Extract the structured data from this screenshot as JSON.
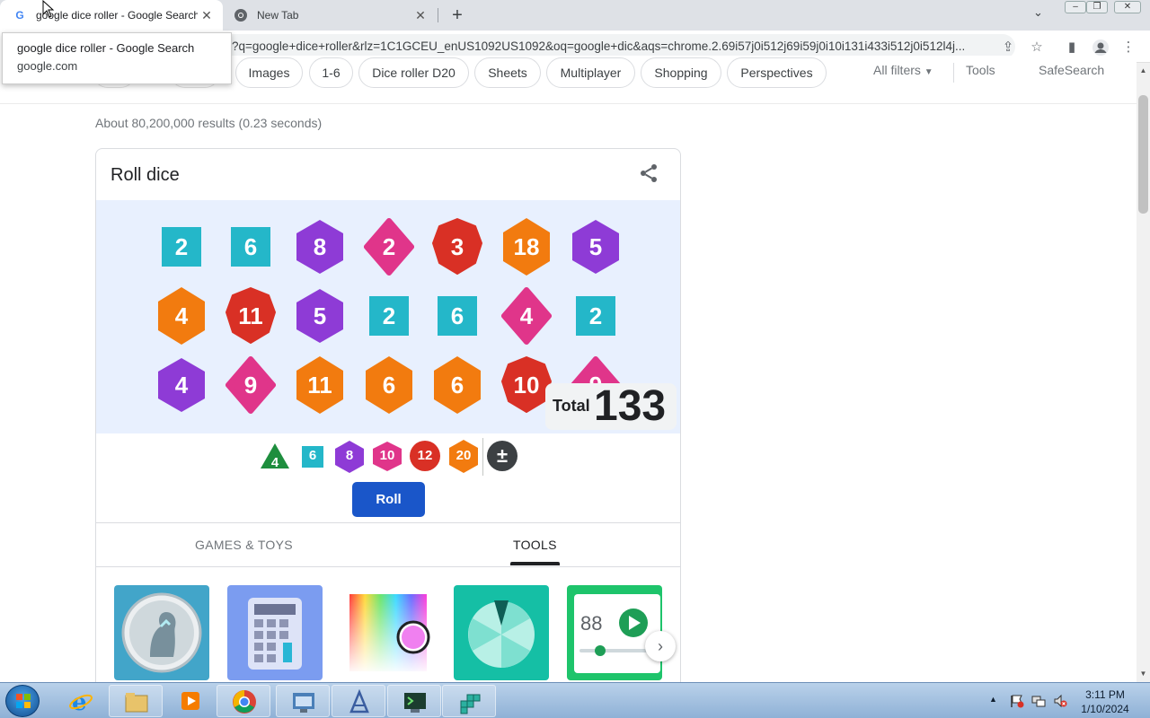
{
  "browser": {
    "tabs": [
      {
        "title": "google dice roller - Google Search",
        "favicon": "G"
      },
      {
        "title": "New Tab",
        "favicon": "chrome-icon"
      }
    ],
    "new_tab_symbol": "+",
    "address": "?q=google+dice+roller&rlz=1C1GCEU_enUS1092US1092&oq=google+dic&aqs=chrome.2.69i57j0i512j69i59j0i10i131i433i512j0i512l4j...",
    "tooltip": {
      "title": "google dice roller - Google Search",
      "domain": "google.com"
    }
  },
  "filters": {
    "chips": [
      "Images",
      "1-6",
      "Dice roller D20",
      "Sheets",
      "Multiplayer",
      "Shopping",
      "Perspectives"
    ],
    "all_filters": "All filters",
    "tools": "Tools",
    "safesearch": "SafeSearch"
  },
  "results_count": "About 80,200,000 results (0.23 seconds)",
  "dice_card": {
    "title": "Roll dice",
    "total_label": "Total",
    "total_value": "133",
    "dice": [
      {
        "value": "2",
        "type": "d6"
      },
      {
        "value": "6",
        "type": "d6"
      },
      {
        "value": "8",
        "type": "d8"
      },
      {
        "value": "2",
        "type": "d10"
      },
      {
        "value": "3",
        "type": "d12"
      },
      {
        "value": "18",
        "type": "d20"
      },
      {
        "value": "5",
        "type": "d8"
      },
      {
        "value": "4",
        "type": "d20"
      },
      {
        "value": "11",
        "type": "d12"
      },
      {
        "value": "5",
        "type": "d8"
      },
      {
        "value": "2",
        "type": "d6"
      },
      {
        "value": "6",
        "type": "d6"
      },
      {
        "value": "4",
        "type": "d10"
      },
      {
        "value": "2",
        "type": "d6"
      },
      {
        "value": "4",
        "type": "d8"
      },
      {
        "value": "9",
        "type": "d10"
      },
      {
        "value": "11",
        "type": "d20"
      },
      {
        "value": "6",
        "type": "d20"
      },
      {
        "value": "6",
        "type": "d20"
      },
      {
        "value": "10",
        "type": "d12"
      },
      {
        "value": "9",
        "type": "d10"
      }
    ],
    "pickers": [
      {
        "label": "4",
        "type": "d4"
      },
      {
        "label": "6",
        "type": "d6"
      },
      {
        "label": "8",
        "type": "d8"
      },
      {
        "label": "10",
        "type": "d10"
      },
      {
        "label": "12",
        "type": "d12"
      },
      {
        "label": "20",
        "type": "d20"
      }
    ],
    "plus_minus": "±",
    "roll_label": "Roll",
    "category_tabs": [
      "GAMES & TOYS",
      "TOOLS"
    ],
    "active_tab": "TOOLS",
    "tile_value": "88",
    "colors": {
      "d4": "#1e8e3e",
      "d6": "#24b7c9",
      "d8": "#8e3bd6",
      "d10": "#e0358a",
      "d12": "#d93025",
      "d20": "#f27b0f"
    }
  },
  "taskbar": {
    "time": "3:11 PM",
    "date": "1/10/2024"
  }
}
